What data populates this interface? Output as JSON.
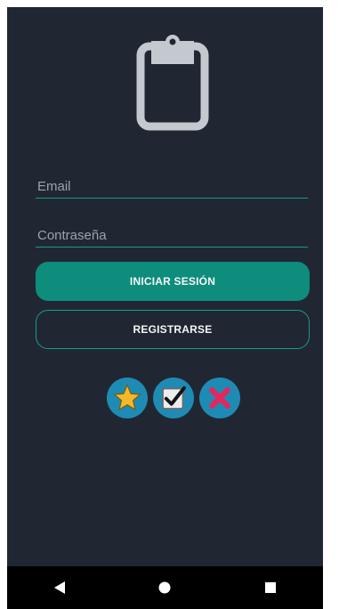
{
  "form": {
    "email_placeholder": "Email",
    "password_placeholder": "Contraseña"
  },
  "buttons": {
    "login_label": "INICIAR SESIÓN",
    "register_label": "REGISTRARSE"
  },
  "icons": {
    "logo": "clipboard-icon",
    "row": [
      "star-icon",
      "checkbox-icon",
      "close-icon"
    ]
  },
  "nav": {
    "back": "back-triangle-icon",
    "home": "home-circle-icon",
    "recents": "recents-square-icon"
  },
  "colors": {
    "background": "#202733",
    "accent": "#0e8c7c",
    "underline": "#1a9a8a",
    "icon_circle": "#1e8bb5",
    "star": "#f4b82a",
    "close": "#e2275e"
  }
}
